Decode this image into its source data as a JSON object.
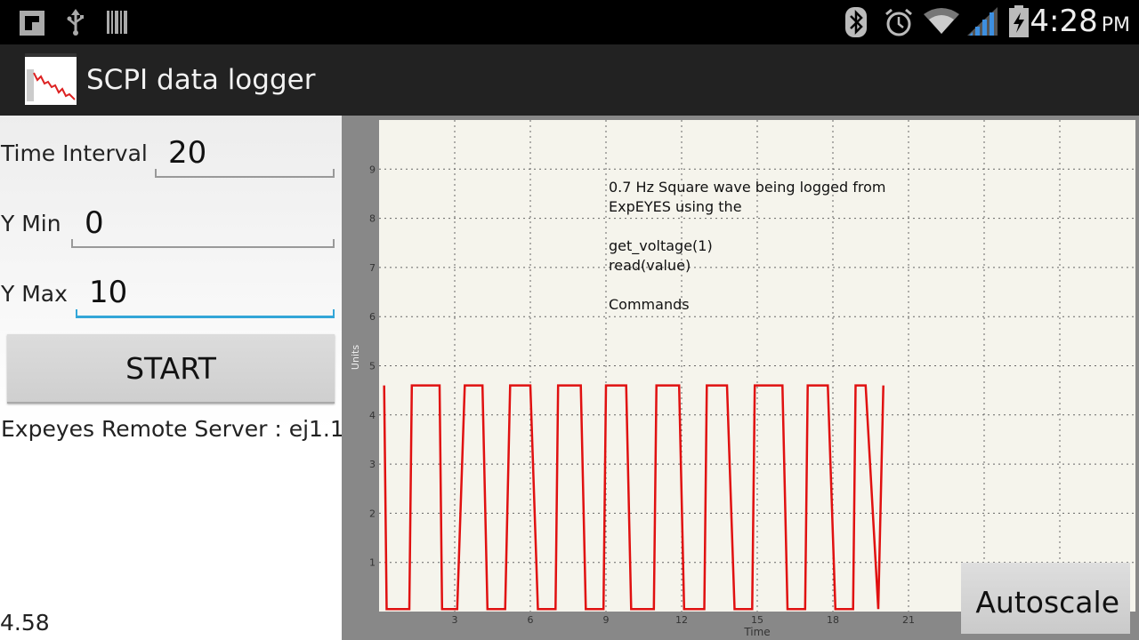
{
  "status_bar": {
    "time": "4:28",
    "ampm": "PM",
    "icons": [
      "flipboard-icon",
      "usb-icon",
      "barcode-icon",
      "bluetooth-icon",
      "alarm-icon",
      "wifi-icon",
      "signal-icon",
      "battery-charging-icon"
    ]
  },
  "action_bar": {
    "title": "SCPI data logger",
    "icon": "waveform-app-icon"
  },
  "form": {
    "time_interval_label": "Time Interval",
    "time_interval_value": "20",
    "ymin_label": "Y Min",
    "ymin_value": "0",
    "ymax_label": "Y Max",
    "ymax_value": "10",
    "start_label": "START"
  },
  "server_text": "Expeyes Remote Server : ej1.1",
  "current_reading": "4.58",
  "autoscale_label": "Autoscale",
  "colors": {
    "plot_bg": "#f5f4ec",
    "trace": "#e01010",
    "grid": "#666666",
    "accent": "#33a6d8"
  },
  "chart_data": {
    "type": "line",
    "xlabel": "Time",
    "ylabel": "Units",
    "xlim": [
      0,
      30
    ],
    "ylim": [
      0,
      10
    ],
    "xticks": [
      3,
      6,
      9,
      12,
      15,
      18,
      21,
      24,
      27
    ],
    "yticks": [
      1,
      2,
      3,
      4,
      5,
      6,
      7,
      8,
      9
    ],
    "grid": true,
    "annotation": [
      "0.7 Hz Square wave being logged from",
      "ExpEYES using the",
      "",
      "get_voltage(1)",
      "read(value)",
      "",
      "Commands"
    ],
    "series": [
      {
        "x": [
          0.2,
          0.3,
          0.5,
          1.2,
          1.3,
          1.6,
          2.4,
          2.5,
          3.1,
          3.4,
          3.6,
          4.1,
          4.3,
          5.0,
          5.2,
          5.5,
          6.0,
          6.3,
          7.0,
          7.1,
          7.4,
          8.0,
          8.2,
          8.9,
          9.0,
          9.3,
          9.8,
          10.0,
          10.9,
          11.0,
          11.3,
          11.9,
          12.1,
          12.9,
          13.0,
          13.3,
          13.8,
          14.1,
          14.8,
          14.9,
          15.3,
          16.0,
          16.2,
          16.9,
          17.0,
          17.3,
          17.8,
          18.1,
          18.8,
          18.9,
          19.3,
          19.8,
          20.0
        ],
        "values": [
          4.6,
          0.05,
          0.05,
          0.05,
          4.6,
          4.6,
          4.6,
          0.05,
          0.05,
          4.6,
          4.6,
          4.6,
          0.05,
          0.05,
          4.6,
          4.6,
          4.6,
          0.05,
          0.05,
          4.6,
          4.6,
          4.6,
          0.05,
          0.05,
          4.6,
          4.6,
          4.6,
          0.05,
          0.05,
          4.6,
          4.6,
          4.6,
          0.05,
          0.05,
          4.6,
          4.6,
          4.6,
          0.05,
          0.05,
          4.6,
          4.6,
          4.6,
          0.05,
          0.05,
          4.6,
          4.6,
          4.6,
          0.05,
          0.05,
          4.6,
          4.6,
          0.05,
          4.6
        ]
      }
    ]
  }
}
